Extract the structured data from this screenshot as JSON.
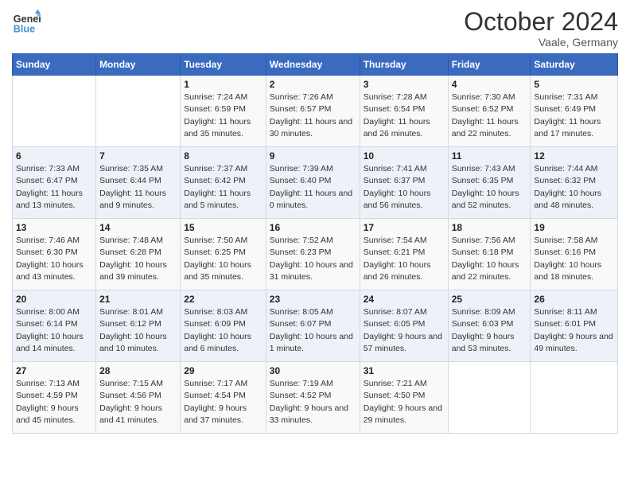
{
  "header": {
    "logo_line1": "General",
    "logo_line2": "Blue",
    "month": "October 2024",
    "location": "Vaale, Germany"
  },
  "days_of_week": [
    "Sunday",
    "Monday",
    "Tuesday",
    "Wednesday",
    "Thursday",
    "Friday",
    "Saturday"
  ],
  "weeks": [
    [
      {
        "day": "",
        "info": ""
      },
      {
        "day": "",
        "info": ""
      },
      {
        "day": "1",
        "info": "Sunrise: 7:24 AM\nSunset: 6:59 PM\nDaylight: 11 hours and 35 minutes."
      },
      {
        "day": "2",
        "info": "Sunrise: 7:26 AM\nSunset: 6:57 PM\nDaylight: 11 hours and 30 minutes."
      },
      {
        "day": "3",
        "info": "Sunrise: 7:28 AM\nSunset: 6:54 PM\nDaylight: 11 hours and 26 minutes."
      },
      {
        "day": "4",
        "info": "Sunrise: 7:30 AM\nSunset: 6:52 PM\nDaylight: 11 hours and 22 minutes."
      },
      {
        "day": "5",
        "info": "Sunrise: 7:31 AM\nSunset: 6:49 PM\nDaylight: 11 hours and 17 minutes."
      }
    ],
    [
      {
        "day": "6",
        "info": "Sunrise: 7:33 AM\nSunset: 6:47 PM\nDaylight: 11 hours and 13 minutes."
      },
      {
        "day": "7",
        "info": "Sunrise: 7:35 AM\nSunset: 6:44 PM\nDaylight: 11 hours and 9 minutes."
      },
      {
        "day": "8",
        "info": "Sunrise: 7:37 AM\nSunset: 6:42 PM\nDaylight: 11 hours and 5 minutes."
      },
      {
        "day": "9",
        "info": "Sunrise: 7:39 AM\nSunset: 6:40 PM\nDaylight: 11 hours and 0 minutes."
      },
      {
        "day": "10",
        "info": "Sunrise: 7:41 AM\nSunset: 6:37 PM\nDaylight: 10 hours and 56 minutes."
      },
      {
        "day": "11",
        "info": "Sunrise: 7:43 AM\nSunset: 6:35 PM\nDaylight: 10 hours and 52 minutes."
      },
      {
        "day": "12",
        "info": "Sunrise: 7:44 AM\nSunset: 6:32 PM\nDaylight: 10 hours and 48 minutes."
      }
    ],
    [
      {
        "day": "13",
        "info": "Sunrise: 7:46 AM\nSunset: 6:30 PM\nDaylight: 10 hours and 43 minutes."
      },
      {
        "day": "14",
        "info": "Sunrise: 7:48 AM\nSunset: 6:28 PM\nDaylight: 10 hours and 39 minutes."
      },
      {
        "day": "15",
        "info": "Sunrise: 7:50 AM\nSunset: 6:25 PM\nDaylight: 10 hours and 35 minutes."
      },
      {
        "day": "16",
        "info": "Sunrise: 7:52 AM\nSunset: 6:23 PM\nDaylight: 10 hours and 31 minutes."
      },
      {
        "day": "17",
        "info": "Sunrise: 7:54 AM\nSunset: 6:21 PM\nDaylight: 10 hours and 26 minutes."
      },
      {
        "day": "18",
        "info": "Sunrise: 7:56 AM\nSunset: 6:18 PM\nDaylight: 10 hours and 22 minutes."
      },
      {
        "day": "19",
        "info": "Sunrise: 7:58 AM\nSunset: 6:16 PM\nDaylight: 10 hours and 18 minutes."
      }
    ],
    [
      {
        "day": "20",
        "info": "Sunrise: 8:00 AM\nSunset: 6:14 PM\nDaylight: 10 hours and 14 minutes."
      },
      {
        "day": "21",
        "info": "Sunrise: 8:01 AM\nSunset: 6:12 PM\nDaylight: 10 hours and 10 minutes."
      },
      {
        "day": "22",
        "info": "Sunrise: 8:03 AM\nSunset: 6:09 PM\nDaylight: 10 hours and 6 minutes."
      },
      {
        "day": "23",
        "info": "Sunrise: 8:05 AM\nSunset: 6:07 PM\nDaylight: 10 hours and 1 minute."
      },
      {
        "day": "24",
        "info": "Sunrise: 8:07 AM\nSunset: 6:05 PM\nDaylight: 9 hours and 57 minutes."
      },
      {
        "day": "25",
        "info": "Sunrise: 8:09 AM\nSunset: 6:03 PM\nDaylight: 9 hours and 53 minutes."
      },
      {
        "day": "26",
        "info": "Sunrise: 8:11 AM\nSunset: 6:01 PM\nDaylight: 9 hours and 49 minutes."
      }
    ],
    [
      {
        "day": "27",
        "info": "Sunrise: 7:13 AM\nSunset: 4:59 PM\nDaylight: 9 hours and 45 minutes."
      },
      {
        "day": "28",
        "info": "Sunrise: 7:15 AM\nSunset: 4:56 PM\nDaylight: 9 hours and 41 minutes."
      },
      {
        "day": "29",
        "info": "Sunrise: 7:17 AM\nSunset: 4:54 PM\nDaylight: 9 hours and 37 minutes."
      },
      {
        "day": "30",
        "info": "Sunrise: 7:19 AM\nSunset: 4:52 PM\nDaylight: 9 hours and 33 minutes."
      },
      {
        "day": "31",
        "info": "Sunrise: 7:21 AM\nSunset: 4:50 PM\nDaylight: 9 hours and 29 minutes."
      },
      {
        "day": "",
        "info": ""
      },
      {
        "day": "",
        "info": ""
      }
    ]
  ]
}
